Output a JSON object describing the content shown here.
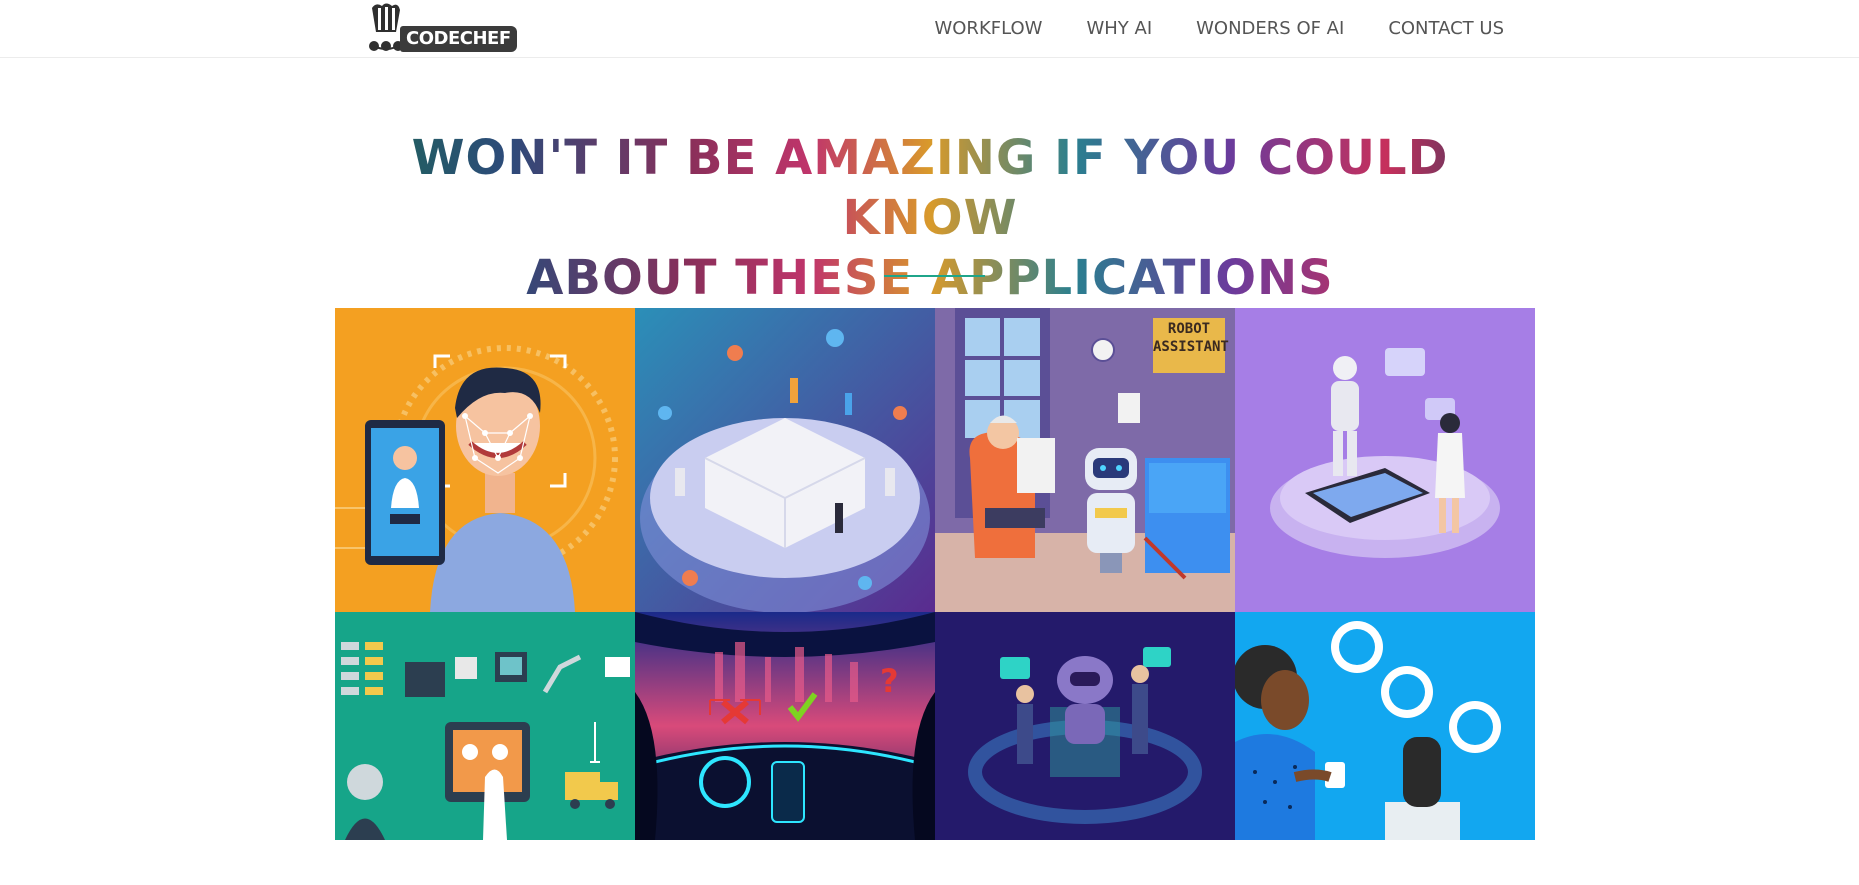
{
  "logo": {
    "text": "CODECHEF"
  },
  "nav": {
    "items": [
      "WORKFLOW",
      "WHY AI",
      "WONDERS OF AI",
      "CONTACT US"
    ]
  },
  "heading": {
    "line1": "WON'T IT BE AMAZING IF YOU COULD KNOW",
    "line2": "ABOUT THESE APPLICATIONS"
  },
  "tiles": {
    "robot_assistant_sign": [
      "ROBOT",
      "ASSISTANT"
    ]
  },
  "colors": {
    "accent": "#1fa58a",
    "tile_orange": "#f4a021",
    "tile_violet": "#a67ee6",
    "tile_teal": "#16a589",
    "tile_indigo": "#241a6b",
    "tile_sky": "#12a7f0"
  }
}
